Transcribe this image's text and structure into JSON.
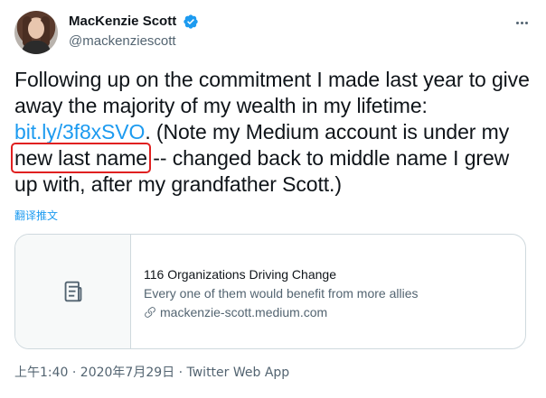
{
  "user": {
    "display_name": "MacKenzie Scott",
    "handle": "@mackenziescott",
    "verified": true
  },
  "tweet": {
    "text_part1": "Following up on the commitment I made last year to give away the majority of my wealth in my lifetime: ",
    "link_text": "bit.ly/3f8xSVO",
    "text_part2": ". (Note my Medium account is under my ",
    "highlighted_text": "new last name",
    "text_part3": " -- changed back to middle name I grew up with, after my grandfather Scott.)"
  },
  "translate_label": "翻译推文",
  "card": {
    "title": "116 Organizations Driving Change",
    "description": "Every one of them would benefit from more allies",
    "domain": "mackenzie-scott.medium.com",
    "thumb_icon": "document-icon",
    "domain_icon": "link-icon"
  },
  "meta": {
    "timestamp": "上午1:40 · 2020年7月29日 · Twitter Web App"
  },
  "colors": {
    "link": "#1d9bf0",
    "highlight_outline": "#e02020",
    "secondary_text": "#536471"
  }
}
